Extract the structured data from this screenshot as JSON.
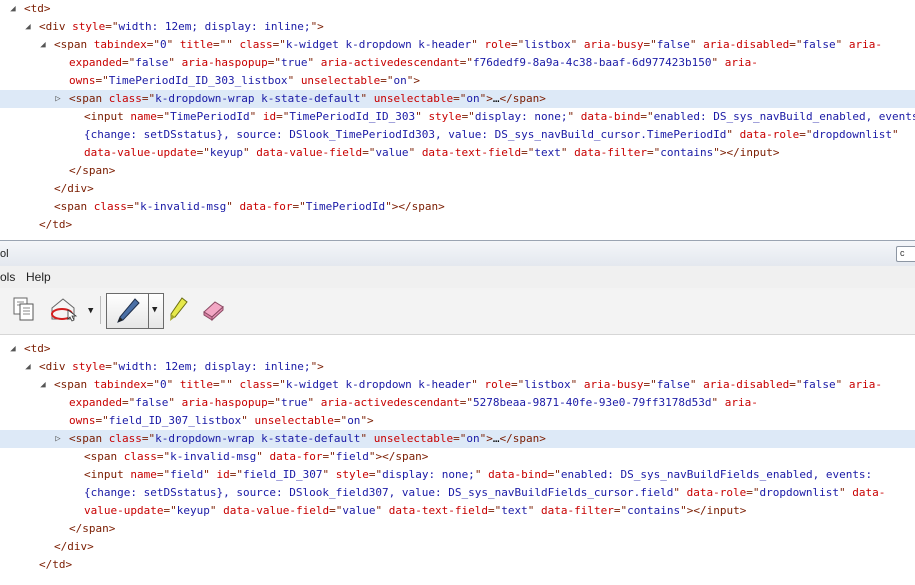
{
  "devtools": {
    "title_fragment": "ol"
  },
  "close_box": "c",
  "menu": [
    {
      "label": "ols"
    },
    {
      "label": "Help"
    }
  ],
  "top_lines": [
    {
      "indent": 0,
      "arrow": "◢",
      "html": [
        [
          "t",
          "<td>"
        ]
      ]
    },
    {
      "indent": 1,
      "arrow": "◢",
      "html": [
        [
          "t",
          "<div "
        ],
        [
          "an",
          "style"
        ],
        [
          "t",
          "=\""
        ],
        [
          "av",
          "width: 12em; display: inline;"
        ],
        [
          "t",
          "\">"
        ]
      ]
    },
    {
      "indent": 2,
      "arrow": "◢",
      "html": [
        [
          "t",
          "<span "
        ],
        [
          "an",
          "tabindex"
        ],
        [
          "t",
          "=\""
        ],
        [
          "av",
          "0"
        ],
        [
          "t",
          "\" "
        ],
        [
          "an",
          "title"
        ],
        [
          "t",
          "=\"\" "
        ],
        [
          "an",
          "class"
        ],
        [
          "t",
          "=\""
        ],
        [
          "av",
          "k-widget k-dropdown k-header"
        ],
        [
          "t",
          "\" "
        ],
        [
          "an",
          "role"
        ],
        [
          "t",
          "=\""
        ],
        [
          "av",
          "listbox"
        ],
        [
          "t",
          "\" "
        ],
        [
          "an",
          "aria-busy"
        ],
        [
          "t",
          "=\""
        ],
        [
          "av",
          "false"
        ],
        [
          "t",
          "\" "
        ],
        [
          "an",
          "aria-disabled"
        ],
        [
          "t",
          "=\""
        ],
        [
          "av",
          "false"
        ],
        [
          "t",
          "\" "
        ],
        [
          "an",
          "aria-"
        ]
      ]
    },
    {
      "indent": 3,
      "arrow": "",
      "html": [
        [
          "an",
          "expanded"
        ],
        [
          "t",
          "=\""
        ],
        [
          "av",
          "false"
        ],
        [
          "t",
          "\" "
        ],
        [
          "an",
          "aria-haspopup"
        ],
        [
          "t",
          "=\""
        ],
        [
          "av",
          "true"
        ],
        [
          "t",
          "\" "
        ],
        [
          "an",
          "aria-activedescendant"
        ],
        [
          "t",
          "=\""
        ],
        [
          "av",
          "f76dedf9-8a9a-4c38-baaf-6d977423b150"
        ],
        [
          "t",
          "\" "
        ],
        [
          "an",
          "aria-"
        ]
      ]
    },
    {
      "indent": 3,
      "arrow": "",
      "html": [
        [
          "an",
          "owns"
        ],
        [
          "t",
          "=\""
        ],
        [
          "av",
          "TimePeriodId_ID_303_listbox"
        ],
        [
          "t",
          "\" "
        ],
        [
          "an",
          "unselectable"
        ],
        [
          "t",
          "=\""
        ],
        [
          "av",
          "on"
        ],
        [
          "t",
          "\">"
        ]
      ]
    },
    {
      "indent": 3,
      "arrow": "▷",
      "hl": true,
      "html": [
        [
          "t",
          "<span "
        ],
        [
          "an",
          "class"
        ],
        [
          "t",
          "=\""
        ],
        [
          "av",
          "k-dropdown-wrap k-state-default"
        ],
        [
          "t",
          "\" "
        ],
        [
          "an",
          "unselectable"
        ],
        [
          "t",
          "=\""
        ],
        [
          "av",
          "on"
        ],
        [
          "t",
          "\">"
        ],
        [
          "tx",
          "…"
        ],
        [
          "t",
          "</span>"
        ]
      ]
    },
    {
      "indent": 4,
      "arrow": "",
      "html": [
        [
          "t",
          "<input "
        ],
        [
          "an",
          "name"
        ],
        [
          "t",
          "=\""
        ],
        [
          "av",
          "TimePeriodId"
        ],
        [
          "t",
          "\" "
        ],
        [
          "an",
          "id"
        ],
        [
          "t",
          "=\""
        ],
        [
          "av",
          "TimePeriodId_ID_303"
        ],
        [
          "t",
          "\" "
        ],
        [
          "an",
          "style"
        ],
        [
          "t",
          "=\""
        ],
        [
          "av",
          "display: none;"
        ],
        [
          "t",
          "\" "
        ],
        [
          "an",
          "data-bind"
        ],
        [
          "t",
          "=\""
        ],
        [
          "av",
          "enabled: DS_sys_navBuild_enabled, events:"
        ]
      ]
    },
    {
      "indent": 4,
      "arrow": "",
      "html": [
        [
          "av",
          "{change: setDSstatus}, source: DSlook_TimePeriodId303, value: DS_sys_navBuild_cursor.TimePeriodId"
        ],
        [
          "t",
          "\" "
        ],
        [
          "an",
          "data-role"
        ],
        [
          "t",
          "=\""
        ],
        [
          "av",
          "dropdownlist"
        ],
        [
          "t",
          "\""
        ]
      ]
    },
    {
      "indent": 4,
      "arrow": "",
      "html": [
        [
          "an",
          "data-value-update"
        ],
        [
          "t",
          "=\""
        ],
        [
          "av",
          "keyup"
        ],
        [
          "t",
          "\" "
        ],
        [
          "an",
          "data-value-field"
        ],
        [
          "t",
          "=\""
        ],
        [
          "av",
          "value"
        ],
        [
          "t",
          "\" "
        ],
        [
          "an",
          "data-text-field"
        ],
        [
          "t",
          "=\""
        ],
        [
          "av",
          "text"
        ],
        [
          "t",
          "\" "
        ],
        [
          "an",
          "data-filter"
        ],
        [
          "t",
          "=\""
        ],
        [
          "av",
          "contains"
        ],
        [
          "t",
          "\"></input>"
        ]
      ]
    },
    {
      "indent": 3,
      "arrow": "",
      "html": [
        [
          "t",
          "</span>"
        ]
      ]
    },
    {
      "indent": 2,
      "arrow": "",
      "html": [
        [
          "t",
          "</div>"
        ]
      ]
    },
    {
      "indent": 2,
      "arrow": "",
      "html": [
        [
          "t",
          "<span "
        ],
        [
          "an",
          "class"
        ],
        [
          "t",
          "=\""
        ],
        [
          "av",
          "k-invalid-msg"
        ],
        [
          "t",
          "\" "
        ],
        [
          "an",
          "data-for"
        ],
        [
          "t",
          "=\""
        ],
        [
          "av",
          "TimePeriodId"
        ],
        [
          "t",
          "\"></span>"
        ]
      ]
    },
    {
      "indent": 1,
      "arrow": "",
      "html": [
        [
          "t",
          "</td>"
        ]
      ]
    }
  ],
  "bottom_lines": [
    {
      "indent": 0,
      "arrow": "◢",
      "html": [
        [
          "t",
          "<td>"
        ]
      ]
    },
    {
      "indent": 1,
      "arrow": "◢",
      "html": [
        [
          "t",
          "<div "
        ],
        [
          "an",
          "style"
        ],
        [
          "t",
          "=\""
        ],
        [
          "av",
          "width: 12em; display: inline;"
        ],
        [
          "t",
          "\">"
        ]
      ]
    },
    {
      "indent": 2,
      "arrow": "◢",
      "html": [
        [
          "t",
          "<span "
        ],
        [
          "an",
          "tabindex"
        ],
        [
          "t",
          "=\""
        ],
        [
          "av",
          "0"
        ],
        [
          "t",
          "\" "
        ],
        [
          "an",
          "title"
        ],
        [
          "t",
          "=\"\" "
        ],
        [
          "an",
          "class"
        ],
        [
          "t",
          "=\""
        ],
        [
          "av",
          "k-widget k-dropdown k-header"
        ],
        [
          "t",
          "\" "
        ],
        [
          "an",
          "role"
        ],
        [
          "t",
          "=\""
        ],
        [
          "av",
          "listbox"
        ],
        [
          "t",
          "\" "
        ],
        [
          "an",
          "aria-busy"
        ],
        [
          "t",
          "=\""
        ],
        [
          "av",
          "false"
        ],
        [
          "t",
          "\" "
        ],
        [
          "an",
          "aria-disabled"
        ],
        [
          "t",
          "=\""
        ],
        [
          "av",
          "false"
        ],
        [
          "t",
          "\" "
        ],
        [
          "an",
          "aria-"
        ]
      ]
    },
    {
      "indent": 3,
      "arrow": "",
      "html": [
        [
          "an",
          "expanded"
        ],
        [
          "t",
          "=\""
        ],
        [
          "av",
          "false"
        ],
        [
          "t",
          "\" "
        ],
        [
          "an",
          "aria-haspopup"
        ],
        [
          "t",
          "=\""
        ],
        [
          "av",
          "true"
        ],
        [
          "t",
          "\" "
        ],
        [
          "an",
          "aria-activedescendant"
        ],
        [
          "t",
          "=\""
        ],
        [
          "av",
          "5278beaa-9871-40fe-93e0-79ff3178d53d"
        ],
        [
          "t",
          "\" "
        ],
        [
          "an",
          "aria-"
        ]
      ]
    },
    {
      "indent": 3,
      "arrow": "",
      "html": [
        [
          "an",
          "owns"
        ],
        [
          "t",
          "=\""
        ],
        [
          "av",
          "field_ID_307_listbox"
        ],
        [
          "t",
          "\" "
        ],
        [
          "an",
          "unselectable"
        ],
        [
          "t",
          "=\""
        ],
        [
          "av",
          "on"
        ],
        [
          "t",
          "\">"
        ]
      ]
    },
    {
      "indent": 3,
      "arrow": "▷",
      "hl": true,
      "html": [
        [
          "t",
          "<span "
        ],
        [
          "an",
          "class"
        ],
        [
          "t",
          "=\""
        ],
        [
          "av",
          "k-dropdown-wrap k-state-default"
        ],
        [
          "t",
          "\" "
        ],
        [
          "an",
          "unselectable"
        ],
        [
          "t",
          "=\""
        ],
        [
          "av",
          "on"
        ],
        [
          "t",
          "\">"
        ],
        [
          "tx",
          "…"
        ],
        [
          "t",
          "</span>"
        ]
      ]
    },
    {
      "indent": 4,
      "arrow": "",
      "html": [
        [
          "t",
          "<span "
        ],
        [
          "an",
          "class"
        ],
        [
          "t",
          "=\""
        ],
        [
          "av",
          "k-invalid-msg"
        ],
        [
          "t",
          "\" "
        ],
        [
          "an",
          "data-for"
        ],
        [
          "t",
          "=\""
        ],
        [
          "av",
          "field"
        ],
        [
          "t",
          "\"></span>"
        ]
      ]
    },
    {
      "indent": 4,
      "arrow": "",
      "html": [
        [
          "t",
          "<input "
        ],
        [
          "an",
          "name"
        ],
        [
          "t",
          "=\""
        ],
        [
          "av",
          "field"
        ],
        [
          "t",
          "\" "
        ],
        [
          "an",
          "id"
        ],
        [
          "t",
          "=\""
        ],
        [
          "av",
          "field_ID_307"
        ],
        [
          "t",
          "\" "
        ],
        [
          "an",
          "style"
        ],
        [
          "t",
          "=\""
        ],
        [
          "av",
          "display: none;"
        ],
        [
          "t",
          "\" "
        ],
        [
          "an",
          "data-bind"
        ],
        [
          "t",
          "=\""
        ],
        [
          "av",
          "enabled: DS_sys_navBuildFields_enabled, events:"
        ]
      ]
    },
    {
      "indent": 4,
      "arrow": "",
      "html": [
        [
          "av",
          "{change: setDSstatus}, source: DSlook_field307, value: DS_sys_navBuildFields_cursor.field"
        ],
        [
          "t",
          "\" "
        ],
        [
          "an",
          "data-role"
        ],
        [
          "t",
          "=\""
        ],
        [
          "av",
          "dropdownlist"
        ],
        [
          "t",
          "\" "
        ],
        [
          "an",
          "data-"
        ]
      ]
    },
    {
      "indent": 4,
      "arrow": "",
      "html": [
        [
          "an",
          "value-update"
        ],
        [
          "t",
          "=\""
        ],
        [
          "av",
          "keyup"
        ],
        [
          "t",
          "\" "
        ],
        [
          "an",
          "data-value-field"
        ],
        [
          "t",
          "=\""
        ],
        [
          "av",
          "value"
        ],
        [
          "t",
          "\" "
        ],
        [
          "an",
          "data-text-field"
        ],
        [
          "t",
          "=\""
        ],
        [
          "av",
          "text"
        ],
        [
          "t",
          "\" "
        ],
        [
          "an",
          "data-filter"
        ],
        [
          "t",
          "=\""
        ],
        [
          "av",
          "contains"
        ],
        [
          "t",
          "\"></input>"
        ]
      ]
    },
    {
      "indent": 3,
      "arrow": "",
      "html": [
        [
          "t",
          "</span>"
        ]
      ]
    },
    {
      "indent": 2,
      "arrow": "",
      "html": [
        [
          "t",
          "</div>"
        ]
      ]
    },
    {
      "indent": 1,
      "arrow": "",
      "html": [
        [
          "t",
          "</td>"
        ]
      ]
    }
  ],
  "icons": {
    "copy": "copy-icon",
    "select_element": "select-element-icon",
    "pen": "pen-icon",
    "highlighter": "highlighter-icon",
    "eraser": "eraser-icon"
  }
}
